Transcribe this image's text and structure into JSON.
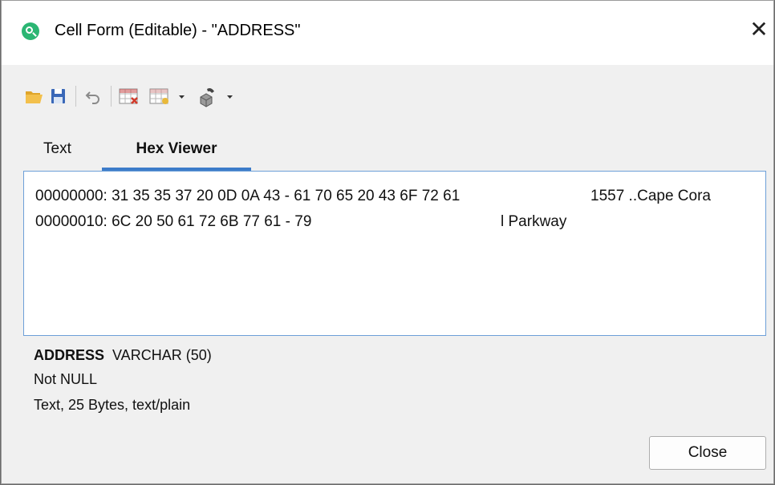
{
  "window": {
    "title": "Cell Form (Editable) - \"ADDRESS\"",
    "close_glyph": "✕"
  },
  "toolbar": {
    "icons": [
      "open-folder-icon",
      "save-icon",
      "undo-icon",
      "clear-grid-icon",
      "grid-options-icon",
      "dropdown-arrow-icon",
      "encoding-icon",
      "dropdown-arrow-icon"
    ]
  },
  "tabs": [
    {
      "label": "Text",
      "active": false
    },
    {
      "label": "Hex Viewer",
      "active": true
    }
  ],
  "hex": {
    "lines": [
      {
        "bytes": "00000000: 31 35 35 37 20 0D 0A 43 - 61 70 65 20 43 6F 72 61",
        "ascii": "1557 ..Cape Cora"
      },
      {
        "bytes": "00000010: 6C 20 50 61 72 6B 77 61 - 79",
        "ascii": "l Parkway"
      }
    ]
  },
  "info": {
    "column_name": "ADDRESS",
    "column_type": "VARCHAR (50)",
    "nullability": "Not NULL",
    "details": "Text, 25 Bytes, text/plain"
  },
  "buttons": {
    "close_label": "Close"
  },
  "colors": {
    "accent": "#3d7cc9",
    "app_icon": "#2bb673",
    "background": "#f0f0f0"
  }
}
